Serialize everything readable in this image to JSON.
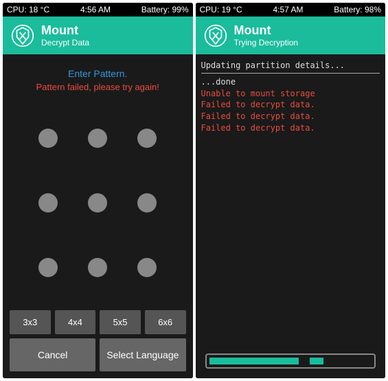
{
  "left": {
    "status": {
      "cpu": "CPU: 18 °C",
      "time": "4:56 AM",
      "battery": "Battery: 99%"
    },
    "header": {
      "title": "Mount",
      "subtitle": "Decrypt Data"
    },
    "prompt": "Enter Pattern.",
    "error": "Pattern failed, please try again!",
    "sizes": [
      "3x3",
      "4x4",
      "5x5",
      "6x6"
    ],
    "cancel": "Cancel",
    "language": "Select Language"
  },
  "right": {
    "status": {
      "cpu": "CPU: 19 °C",
      "time": "4:57 AM",
      "battery": "Battery: 98%"
    },
    "header": {
      "title": "Mount",
      "subtitle": "Trying Decryption"
    },
    "log": {
      "l1": "Updating partition details...",
      "l2": "...done",
      "e1": "Unable to mount storage",
      "e2": "Failed to decrypt data.",
      "e3": "Failed to decrypt data.",
      "e4": "Failed to decrypt data."
    }
  }
}
